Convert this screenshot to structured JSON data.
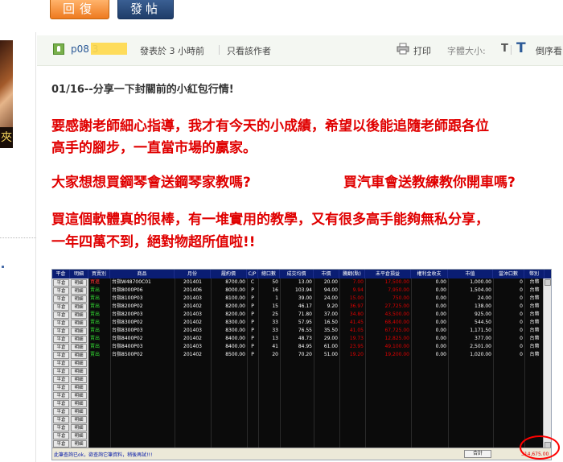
{
  "toolbar": {
    "reply_label": "回復",
    "post_label": "發帖"
  },
  "avatar_text": "夾",
  "post_header": {
    "author": "p08    3",
    "post_time": "發表於 3 小時前",
    "only_author": "只看該作者",
    "print_label": "打印",
    "font_size_label": "字體大小:",
    "font_small": "T",
    "font_large": "T",
    "sort_label": "倒序看"
  },
  "post": {
    "title": "01/16--分享一下封關前的小紅包行情!",
    "line1": "要感謝老師細心指導，我才有今天的小成績，希望以後能追隨老師跟各位",
    "line2": "高手的腳步，一直當市場的贏家。",
    "line3a": "大家想想買鋼琴會送鋼琴家教嗎?",
    "line3b": "買汽車會送教練教你開車嗎?",
    "line4": "買這個軟體真的很棒，有一堆實用的教學，又有很多高手能夠無私分享，",
    "line5": "一年四萬不到，絕對物超所值啦!!"
  },
  "screenshot": {
    "headers": [
      "平倉",
      "明細",
      "買賣別",
      "商品",
      "月份",
      "履約價",
      "C/P",
      "總口數",
      "成交均價",
      "市價",
      "騰翻(點)",
      "未平倉損益",
      "權利金收支",
      "市值",
      "當沖口數",
      "幣別"
    ],
    "button_rows": 21,
    "close_label": "平倉",
    "detail_label": "明細",
    "rows": [
      {
        "side": "買進",
        "product": "台指W48700C01",
        "month": "201401",
        "strike": "8700.00",
        "cp": "C",
        "qty": "50",
        "avg": "13.00",
        "mkt": "20.00",
        "pts": "7.00",
        "pnl": "17,500.00",
        "premium": "0.00",
        "value": "1,000.00",
        "day": "0",
        "cur": "台幣"
      },
      {
        "side": "賣出",
        "product": "台指8000P06",
        "month": "201406",
        "strike": "8000.00",
        "cp": "P",
        "qty": "16",
        "avg": "103.94",
        "mkt": "94.00",
        "pts": "9.94",
        "pnl": "7,950.00",
        "premium": "0.00",
        "value": "1,504.00",
        "day": "0",
        "cur": "台幣"
      },
      {
        "side": "賣出",
        "product": "台指8100P03",
        "month": "201403",
        "strike": "8100.00",
        "cp": "P",
        "qty": "1",
        "avg": "39.00",
        "mkt": "24.00",
        "pts": "15.00",
        "pnl": "750.00",
        "premium": "0.00",
        "value": "24.00",
        "day": "0",
        "cur": "台幣"
      },
      {
        "side": "賣出",
        "product": "台指8200P02",
        "month": "201402",
        "strike": "8200.00",
        "cp": "P",
        "qty": "15",
        "avg": "46.17",
        "mkt": "9.20",
        "pts": "36.97",
        "pnl": "27,725.00",
        "premium": "0.00",
        "value": "138.00",
        "day": "0",
        "cur": "台幣"
      },
      {
        "side": "賣出",
        "product": "台指8200P03",
        "month": "201403",
        "strike": "8200.00",
        "cp": "P",
        "qty": "25",
        "avg": "71.80",
        "mkt": "37.00",
        "pts": "34.80",
        "pnl": "43,500.00",
        "premium": "0.00",
        "value": "925.00",
        "day": "0",
        "cur": "台幣"
      },
      {
        "side": "賣出",
        "product": "台指8300P02",
        "month": "201402",
        "strike": "8300.00",
        "cp": "P",
        "qty": "33",
        "avg": "57.95",
        "mkt": "16.50",
        "pts": "41.45",
        "pnl": "68,400.00",
        "premium": "0.00",
        "value": "544.50",
        "day": "0",
        "cur": "台幣"
      },
      {
        "side": "賣出",
        "product": "台指8300P03",
        "month": "201403",
        "strike": "8300.00",
        "cp": "P",
        "qty": "33",
        "avg": "76.55",
        "mkt": "35.50",
        "pts": "41.05",
        "pnl": "67,725.00",
        "premium": "0.00",
        "value": "1,171.50",
        "day": "0",
        "cur": "台幣"
      },
      {
        "side": "賣出",
        "product": "台指8400P02",
        "month": "201402",
        "strike": "8400.00",
        "cp": "P",
        "qty": "13",
        "avg": "48.73",
        "mkt": "29.00",
        "pts": "19.73",
        "pnl": "12,825.00",
        "premium": "0.00",
        "value": "377.00",
        "day": "0",
        "cur": "台幣"
      },
      {
        "side": "賣出",
        "product": "台指8400P03",
        "month": "201403",
        "strike": "8400.00",
        "cp": "P",
        "qty": "41",
        "avg": "84.95",
        "mkt": "61.00",
        "pts": "23.95",
        "pnl": "49,100.00",
        "premium": "0.00",
        "value": "2,501.00",
        "day": "0",
        "cur": "台幣"
      },
      {
        "side": "賣出",
        "product": "台指8500P02",
        "month": "201402",
        "strike": "8500.00",
        "cp": "P",
        "qty": "20",
        "avg": "70.20",
        "mkt": "51.00",
        "pts": "19.20",
        "pnl": "19,200.00",
        "premium": "0.00",
        "value": "1,020.00",
        "day": "0",
        "cur": "台幣"
      }
    ],
    "status_text": "此筆查詢已ok，欲查詢它筆資料，稍後再試!!!",
    "total_label": "合計",
    "total_value": "314,675.00"
  },
  "colors": {
    "accent_red": "#e00000",
    "header_blue": "#0a1d73",
    "reply_orange": "#ee7a1f",
    "post_navy": "#1f3d69"
  }
}
